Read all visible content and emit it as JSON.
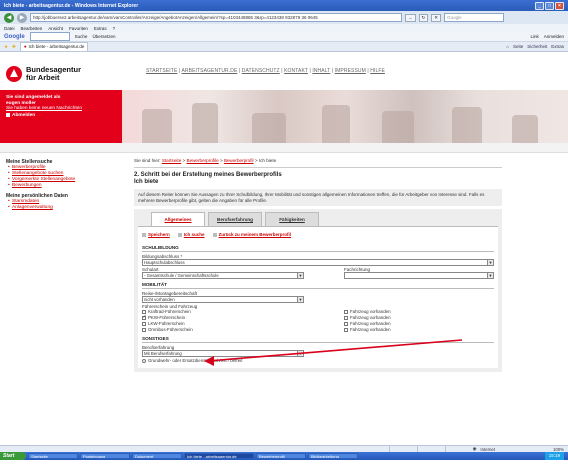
{
  "window": {
    "title": "Ich biete - arbeitsagentur.de - Windows Internet Explorer",
    "controls": [
      "_",
      "□",
      "×"
    ]
  },
  "address": {
    "url": "http://jobboerse2.arbeitsagentur.de/vam/vamController/Anzeige/AngebotAnzeigen/Allgemein/?sp=4103448886 3&rp=4123438 932879 36 0645",
    "go_label": "→",
    "search_placeholder": "Google"
  },
  "menubar": {
    "items": [
      "Datei",
      "Bearbeiten",
      "Ansicht",
      "Favoriten",
      "Extras",
      "?"
    ]
  },
  "toolbar2": {
    "google_label": "Google",
    "search_label": "Suche",
    "translate_label": "Übersetzen",
    "right_items": [
      "Link",
      "Anmelden"
    ]
  },
  "tabsbar": {
    "tab_title": "Ich biete - arbeitsagentur.de",
    "commands": [
      "Seite",
      "Sicherheit",
      "Extras"
    ]
  },
  "site": {
    "logo_line1": "Bundesagentur",
    "logo_line2": "für Arbeit",
    "topnav": [
      "STARTSEITE",
      "ARBEITSAGENTUR.DE",
      "DATENSCHUTZ",
      "KONTAKT",
      "INHALT",
      "IMPRESSUM",
      "HILFE"
    ]
  },
  "banner": {
    "logged_in_line1": "Sie sind angemeldet als",
    "logged_in_line2": "eugen moller",
    "messages_link": "Sie haben keine neuen Nachrichten",
    "logout": "Abmelden"
  },
  "leftnav": {
    "section1_title": "Meine Stellensuche",
    "section1_items": [
      "Bewerberprofile",
      "Stellenangebote suchen",
      "Vorgemerkte Stellenangebote",
      "Bewerbungen"
    ],
    "section2_title": "Meine persönlichen Daten",
    "section2_items": [
      "Stammdaten",
      "Anlagenverwaltung"
    ]
  },
  "breadcrumb": {
    "prefix": "Sie sind hier:",
    "items": [
      "Startseite",
      "Bewerberprofile",
      "Bewerberprofil"
    ],
    "current": "Ich biete"
  },
  "step": {
    "heading_line1": "2. Schritt bei der Erstellung meines Bewerberprofils",
    "heading_line2": "Ich biete",
    "intro": "Auf diesem Reiter können Sie Aussagen zu Ihrer Schulbildung, Ihrer Mobilität und sonstigen allgemeinen Informationen treffen, die für Arbeitgeber von Interesse sind. Falls es mehrere Bewerberprofile gibt, gelten die Angaben für alle Profile."
  },
  "form": {
    "tabs": [
      "Allgemeines",
      "Berufserfahrung",
      "Fähigkeiten"
    ],
    "actions": [
      "Speichern",
      "Ich suche",
      "Zurück zu meinem Bewerberprofil"
    ],
    "schulbildung": {
      "title": "SCHULBILDUNG",
      "abschluss_label": "Bildungsabschluss *",
      "abschluss_value": "Hauptschulabschluss",
      "schulart_label": "Schulart",
      "schulart_value": "- Gesamtschule / Gemeinschaftsschule",
      "fachrichtung_label": "Fachrichtung",
      "fachrichtung_value": ""
    },
    "mobilitaet": {
      "title": "MOBILITÄT",
      "reise_label": "Reise-/Montagebereitschaft",
      "reise_value": "nicht vorhanden",
      "fuehrerschein_label": "Führerschein und Fahrzeug",
      "licenses": [
        {
          "name": "Kraftrad-Führerschein",
          "checked": false,
          "vehicle": "Fahrzeug vorhanden",
          "vehicle_checked": false
        },
        {
          "name": "PKW-Führerschein",
          "checked": true,
          "vehicle": "Fahrzeug vorhanden",
          "vehicle_checked": false
        },
        {
          "name": "LKW-Führerschein",
          "checked": false,
          "vehicle": "Fahrzeug vorhanden",
          "vehicle_checked": false
        },
        {
          "name": "Omnibus-Führerschein",
          "checked": false,
          "vehicle": "Fahrzeug vorhanden",
          "vehicle_checked": false
        }
      ]
    },
    "sonstiges": {
      "title": "SONSTIGES",
      "beruf_label": "Berufserfahrung",
      "beruf_value": "Mit Berufserfahrung",
      "radio_label": "Grundwehr- oder Ersatzdienst absolviert / befreit"
    }
  },
  "statusbar": {
    "zone": "Internet",
    "zoom": "100%"
  },
  "taskbar": {
    "start": "Start",
    "tasks": [
      "Startseite",
      "Posteingang",
      "Dokument",
      "Ich biete - arbeitsagentur.de",
      "Bewerberprofil",
      "Bildbearbeitung"
    ],
    "active_index": 3,
    "clock": "15:19"
  },
  "colors": {
    "brand_red": "#e2001a",
    "link_red": "#cc0000",
    "arrow_red": "#d9001b"
  }
}
